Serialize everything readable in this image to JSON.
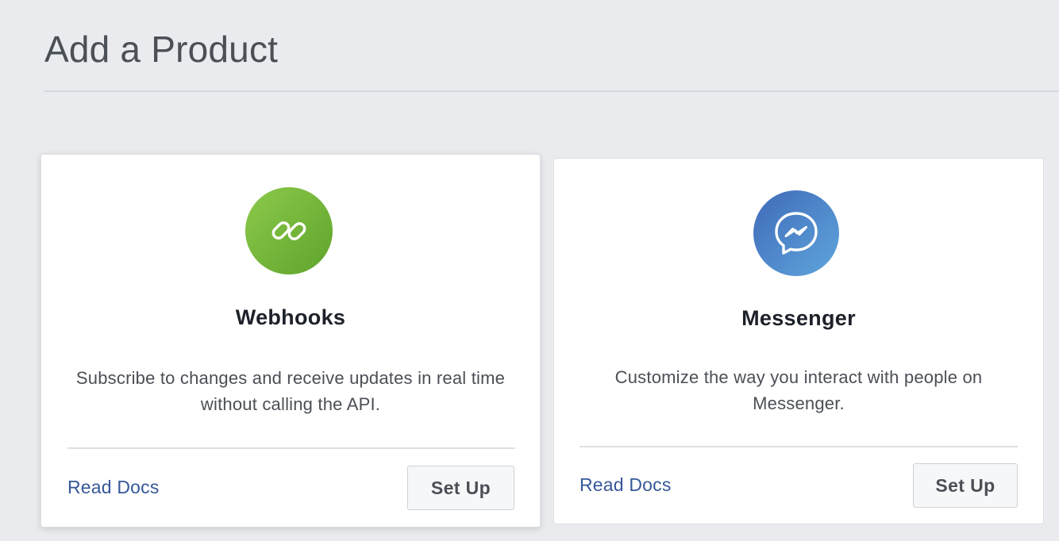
{
  "page": {
    "title": "Add a Product"
  },
  "products": [
    {
      "name": "Webhooks",
      "description": "Subscribe to changes and receive updates in real time without calling the API.",
      "icon": "link-icon",
      "icon_colors": [
        "#8cc94b",
        "#5fa42c"
      ],
      "read_docs_label": "Read Docs",
      "setup_label": "Set Up"
    },
    {
      "name": "Messenger",
      "description": "Customize the way you interact with people on Messenger.",
      "icon": "messenger-icon",
      "icon_colors": [
        "#3f6ab8",
        "#5fa6dd"
      ],
      "read_docs_label": "Read Docs",
      "setup_label": "Set Up"
    }
  ],
  "colors": {
    "background": "#e9ebee",
    "link": "#365899",
    "heading": "#1d2129",
    "body_text": "#4b4f56"
  }
}
